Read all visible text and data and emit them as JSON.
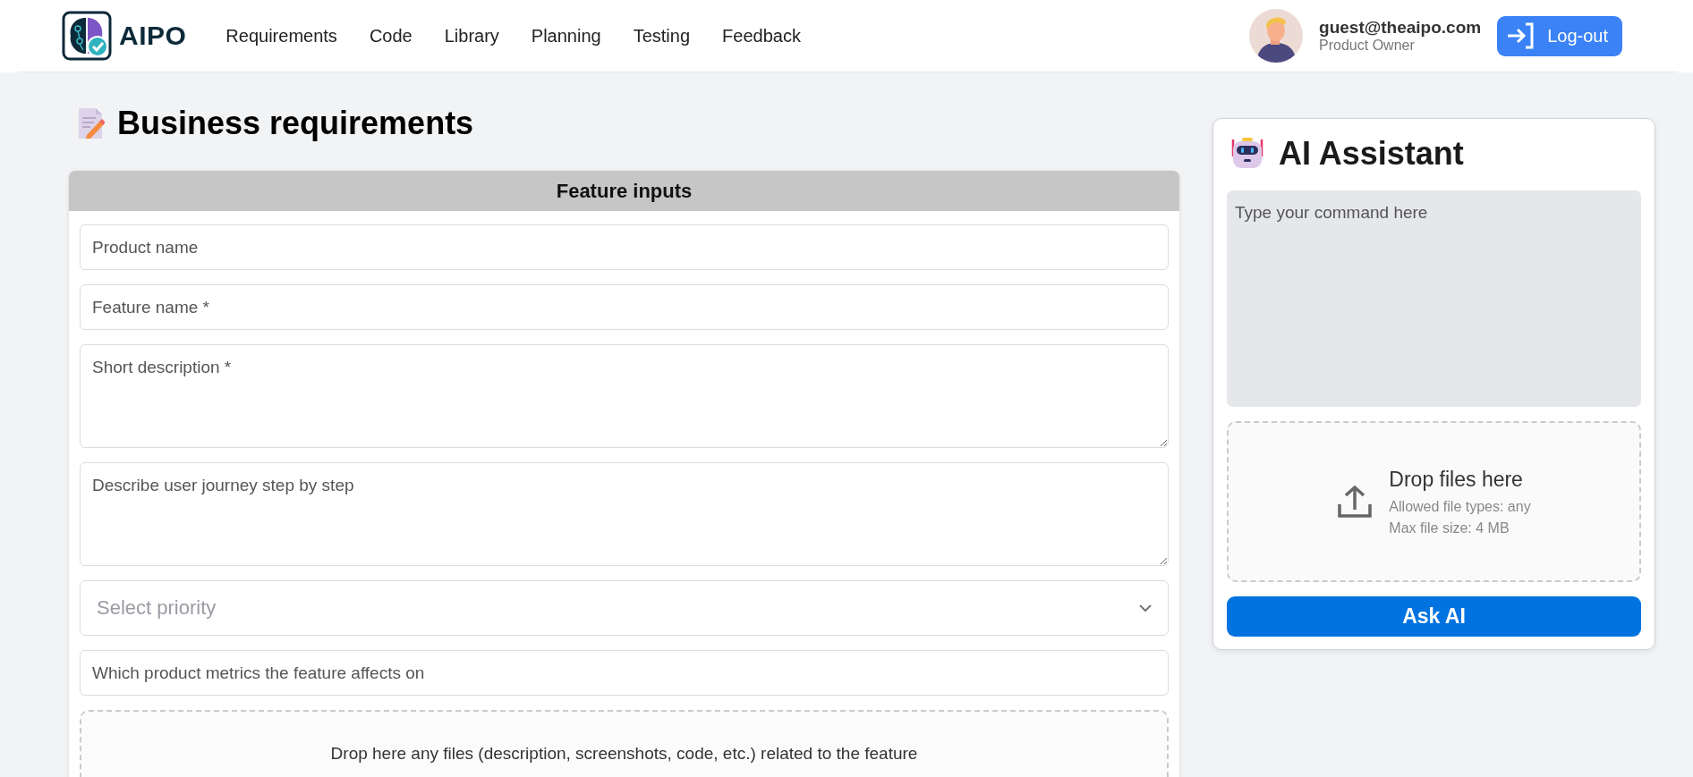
{
  "header": {
    "logo": "AIPO",
    "nav": [
      {
        "label": "Requirements"
      },
      {
        "label": "Code"
      },
      {
        "label": "Library"
      },
      {
        "label": "Planning"
      },
      {
        "label": "Testing"
      },
      {
        "label": "Feedback"
      }
    ],
    "user": {
      "email": "guest@theaipo.com",
      "role": "Product Owner"
    },
    "logout": "Log-out"
  },
  "page": {
    "title": "Business requirements"
  },
  "form": {
    "title": "Feature inputs",
    "fields": [
      {
        "kind": "input",
        "placeholder": "Product name"
      },
      {
        "kind": "input",
        "placeholder": "Feature name *"
      },
      {
        "kind": "textarea",
        "placeholder": "Short description *"
      },
      {
        "kind": "textarea",
        "placeholder": "Describe user journey step by step"
      },
      {
        "kind": "select",
        "placeholder": "Select priority"
      },
      {
        "kind": "input",
        "placeholder": "Which product metrics the feature affects on"
      }
    ],
    "dropzone": {
      "text": "Drop here any files (description, screenshots, code, etc.) related to the feature"
    }
  },
  "assistant": {
    "title": "AI Assistant",
    "command": {
      "placeholder": "Type your command here"
    },
    "dropzone": {
      "title": "Drop files here",
      "lines": [
        "Allowed file types: any",
        "Max file size: 4 MB"
      ]
    },
    "button": "Ask AI"
  }
}
